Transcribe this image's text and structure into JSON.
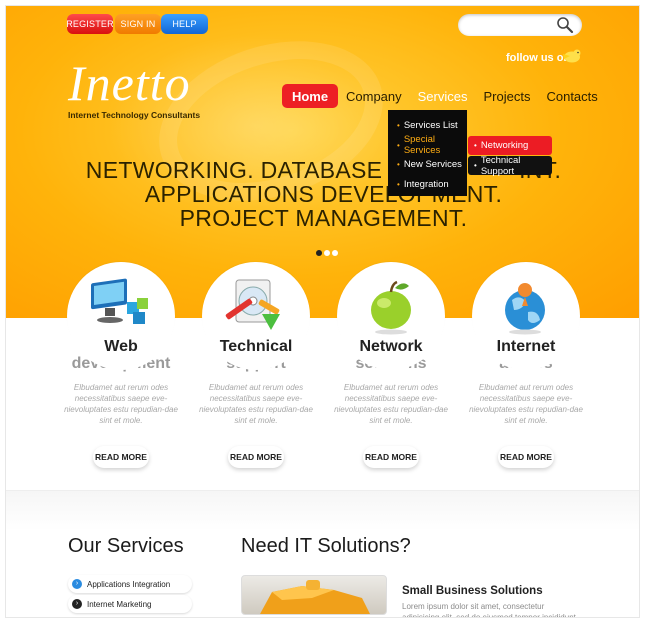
{
  "header": {
    "buttons": {
      "register": "REGISTER",
      "signin": "SIGN IN",
      "help": "HELP"
    },
    "search": {
      "placeholder": "",
      "value": ""
    },
    "follow_text": "follow us on:",
    "logo": "Inetto",
    "tagline": "Internet Technology Consultants"
  },
  "nav": {
    "items": [
      {
        "label": "Home"
      },
      {
        "label": "Company"
      },
      {
        "label": "Services"
      },
      {
        "label": "Projects"
      },
      {
        "label": "Contacts"
      }
    ],
    "dropdown": [
      "Services List",
      "Special Services",
      "New Services",
      "Integration"
    ],
    "submenu": [
      "Networking",
      "Technical Support"
    ]
  },
  "hero": {
    "headline": [
      "NETWORKING. DATABASE MA",
      "APPLICATIONS DEVELOPM",
      "PROJECT MANAGEMENT."
    ],
    "headline_tail": [
      "INT.",
      "ENT."
    ]
  },
  "features": [
    {
      "title": "Web",
      "subtitle": "development",
      "desc": "Elbudamet aut rerum odes necessitatibus saepe eve-nievoluptates estu repudian-dae sint et mole.",
      "button": "READ MORE",
      "icon": "monitor-cubes-icon"
    },
    {
      "title": "Technical",
      "subtitle": "support",
      "desc": "Elbudamet aut rerum odes necessitatibus saepe eve-nievoluptates estu repudian-dae sint et mole.",
      "button": "READ MORE",
      "icon": "tools-cd-icon"
    },
    {
      "title": "Network",
      "subtitle": "solutions",
      "desc": "Elbudamet aut rerum odes necessitatibus saepe eve-nievoluptates estu repudian-dae sint et mole.",
      "button": "READ MORE",
      "icon": "apple-icon"
    },
    {
      "title": "Internet",
      "subtitle": "access",
      "desc": "Elbudamet aut rerum odes necessitatibus saepe eve-nievoluptates estu repudian-dae sint et mole.",
      "button": "READ MORE",
      "icon": "globe-icon"
    }
  ],
  "lower": {
    "services_title": "Our Services",
    "services": [
      "Applications Integration",
      "Internet Marketing"
    ],
    "it_title": "Need IT Solutions?",
    "sb_title": "Small Business Solutions",
    "sb_text": "Lorem ipsum dolor sit amet, consectetur adipisicing elit, sed do eiusmod tempor incididunt ut labore"
  },
  "colors": {
    "accent_red": "#ed1f24",
    "accent_orange": "#ffb30a",
    "accent_blue": "#1266d6"
  }
}
